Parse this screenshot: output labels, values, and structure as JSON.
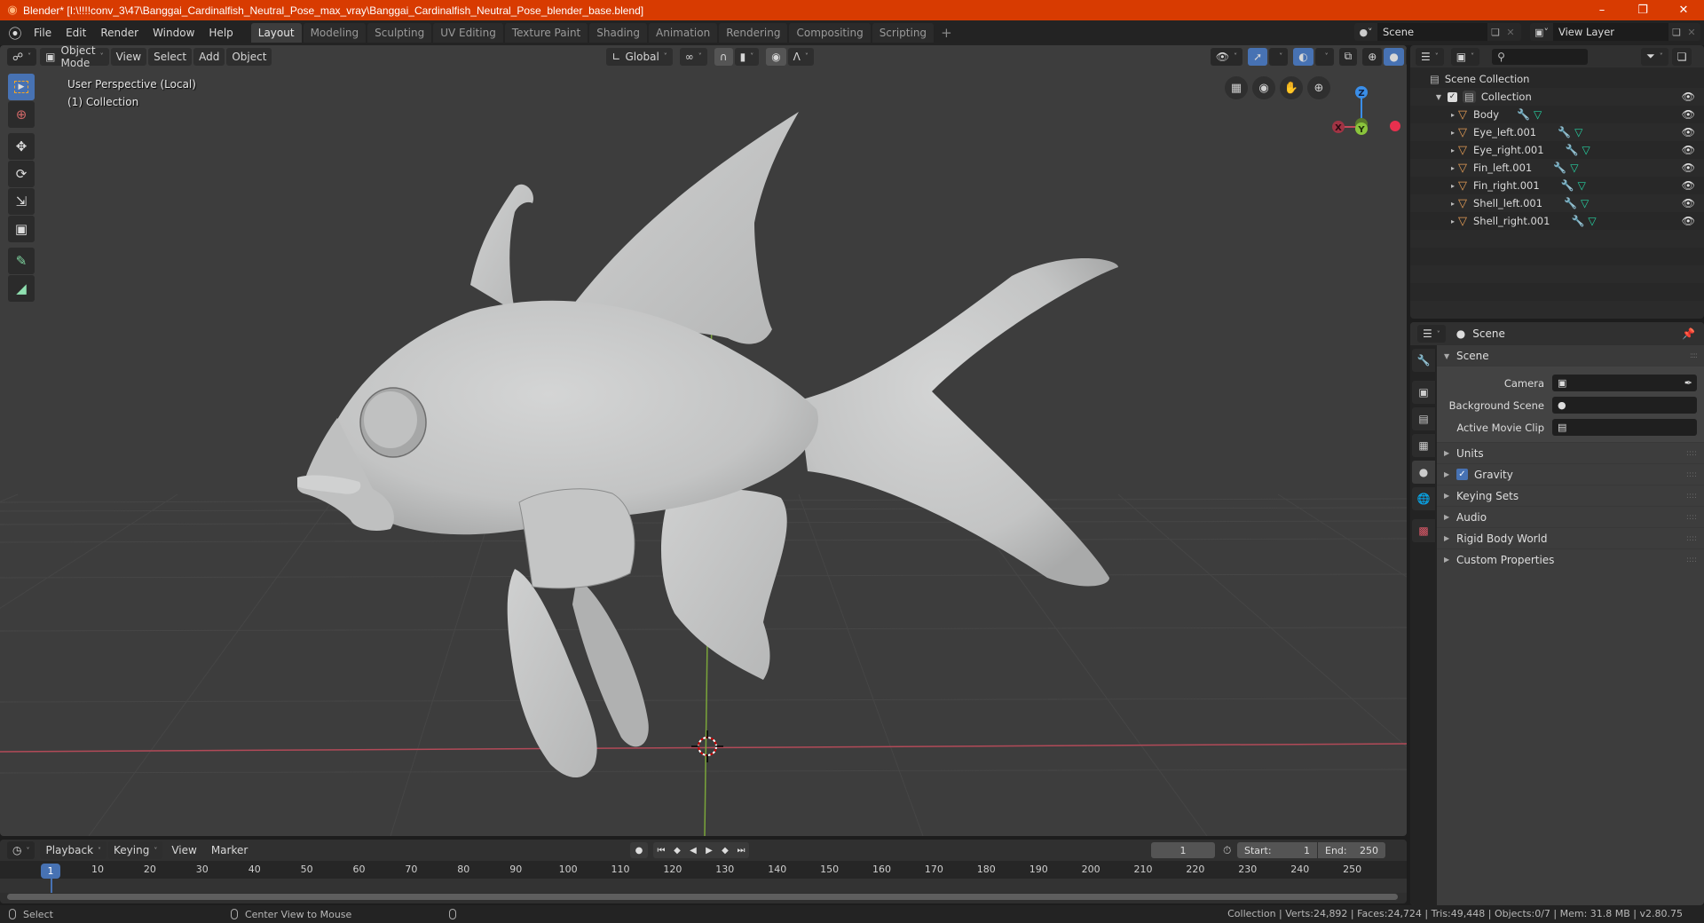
{
  "window": {
    "title": "Blender* [I:\\!!!!conv_3\\47\\Banggai_Cardinalfish_Neutral_Pose_max_vray\\Banggai_Cardinalfish_Neutral_Pose_blender_base.blend]",
    "controls": [
      "minimize",
      "restore",
      "close"
    ]
  },
  "menubar": {
    "items": [
      "File",
      "Edit",
      "Render",
      "Window",
      "Help"
    ],
    "workspaces": [
      "Layout",
      "Modeling",
      "Sculpting",
      "UV Editing",
      "Texture Paint",
      "Shading",
      "Animation",
      "Rendering",
      "Compositing",
      "Scripting"
    ],
    "active_workspace": "Layout",
    "add_workspace": "+",
    "scene": "Scene",
    "view_layer": "View Layer"
  },
  "viewport": {
    "header": {
      "mode": "Object Mode",
      "menus": [
        "View",
        "Select",
        "Add",
        "Object"
      ],
      "orientation": "Global"
    },
    "overlay_text": {
      "view": "User Perspective (Local)",
      "collection": "(1) Collection"
    },
    "tools": [
      "select-box",
      "cursor",
      "move",
      "rotate",
      "scale",
      "transform",
      "annotate",
      "measure"
    ],
    "active_tool": "select-box",
    "nav_buttons": [
      "toggle-ortho",
      "camera-view",
      "pan",
      "zoom"
    ],
    "gizmo_axes": {
      "x": "X",
      "y": "Y",
      "z": "Z"
    },
    "colors": {
      "x_axis": "#c44a5b",
      "y_axis": "#8ac43c",
      "z_axis": "#3a8ee8",
      "background": "#3d3d3d",
      "model": "#c8c9c9"
    }
  },
  "outliner": {
    "root": "Scene Collection",
    "collection": "Collection",
    "objects": [
      {
        "name": "Body"
      },
      {
        "name": "Eye_left.001"
      },
      {
        "name": "Eye_right.001"
      },
      {
        "name": "Fin_left.001"
      },
      {
        "name": "Fin_right.001"
      },
      {
        "name": "Shell_left.001"
      },
      {
        "name": "Shell_right.001"
      }
    ]
  },
  "properties": {
    "header_title": "Scene",
    "panel_title": "Scene",
    "fields": [
      {
        "label": "Camera",
        "value": ""
      },
      {
        "label": "Background Scene",
        "value": ""
      },
      {
        "label": "Active Movie Clip",
        "value": ""
      }
    ],
    "subpanels": [
      {
        "label": "Units",
        "checkbox": false
      },
      {
        "label": "Gravity",
        "checkbox": true,
        "checked": true
      },
      {
        "label": "Keying Sets",
        "checkbox": false
      },
      {
        "label": "Audio",
        "checkbox": false
      },
      {
        "label": "Rigid Body World",
        "checkbox": false
      },
      {
        "label": "Custom Properties",
        "checkbox": false
      }
    ]
  },
  "timeline": {
    "menus": [
      "Playback",
      "Keying",
      "View",
      "Marker"
    ],
    "current_frame": "1",
    "start_label": "Start:",
    "start": "1",
    "end_label": "End:",
    "end": "250",
    "ruler": [
      "10",
      "20",
      "30",
      "40",
      "50",
      "60",
      "70",
      "80",
      "90",
      "100",
      "110",
      "120",
      "130",
      "140",
      "150",
      "160",
      "170",
      "180",
      "190",
      "200",
      "210",
      "220",
      "230",
      "240",
      "250"
    ],
    "cursor_label": "1"
  },
  "statusbar": {
    "left_action": "Select",
    "middle_action": "Center View to Mouse",
    "stats": "Collection | Verts:24,892 | Faces:24,724 | Tris:49,448 | Objects:0/7 | Mem: 31.8 MB | v2.80.75"
  }
}
